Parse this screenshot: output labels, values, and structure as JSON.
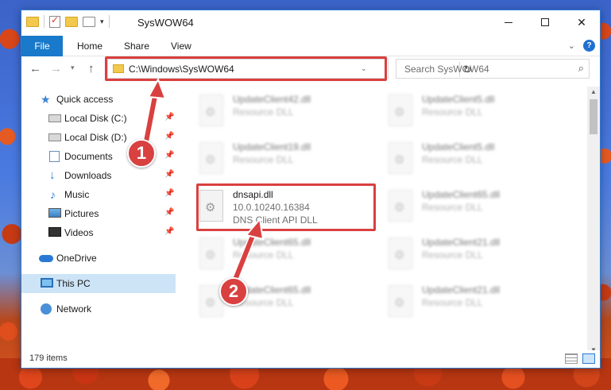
{
  "window": {
    "title": "SysWOW64"
  },
  "ribbon": {
    "tabs": [
      "File",
      "Home",
      "Share",
      "View"
    ],
    "help": "?"
  },
  "address": {
    "path": "C:\\Windows\\SysWOW64",
    "search_placeholder": "Search SysWOW64"
  },
  "sidebar": {
    "items": [
      {
        "label": "Quick access",
        "icon": "star-icon"
      },
      {
        "label": "Local Disk (C:)",
        "icon": "drive-icon"
      },
      {
        "label": "Local Disk (D:)",
        "icon": "drive-icon"
      },
      {
        "label": "Documents",
        "icon": "documents-icon"
      },
      {
        "label": "Downloads",
        "icon": "download-icon"
      },
      {
        "label": "Music",
        "icon": "music-icon"
      },
      {
        "label": "Pictures",
        "icon": "pictures-icon"
      },
      {
        "label": "Videos",
        "icon": "videos-icon"
      },
      {
        "label": "OneDrive",
        "icon": "cloud-icon"
      },
      {
        "label": "This PC",
        "icon": "computer-icon"
      },
      {
        "label": "Network",
        "icon": "network-icon"
      }
    ]
  },
  "files": [
    {
      "name": "UpdateClient42.dll",
      "line2": "Resource DLL",
      "line3": ""
    },
    {
      "name": "UpdateClient5.dll",
      "line2": "Resource DLL",
      "line3": ""
    },
    {
      "name": "UpdateClient19.dll",
      "line2": "Resource DLL",
      "line3": ""
    },
    {
      "name": "UpdateClient5.dll",
      "line2": "Resource DLL",
      "line3": ""
    },
    {
      "name": "dnsapi.dll",
      "line2": "10.0.10240.16384",
      "line3": "DNS Client API DLL"
    },
    {
      "name": "UpdateClient65.dll",
      "line2": "Resource DLL",
      "line3": ""
    },
    {
      "name": "UpdateClient65.dll",
      "line2": "Resource DLL",
      "line3": ""
    },
    {
      "name": "UpdateClient21.dll",
      "line2": "Resource DLL",
      "line3": ""
    },
    {
      "name": "UpdateClient65.dll",
      "line2": "Resource DLL",
      "line3": ""
    },
    {
      "name": "UpdateClient21.dll",
      "line2": "Resource DLL",
      "line3": ""
    }
  ],
  "status": {
    "item_count": "179 items"
  },
  "callouts": [
    "1",
    "2"
  ],
  "colors": {
    "accent": "#1979ca",
    "highlight": "#d94040",
    "selected": "#cde4f7"
  }
}
